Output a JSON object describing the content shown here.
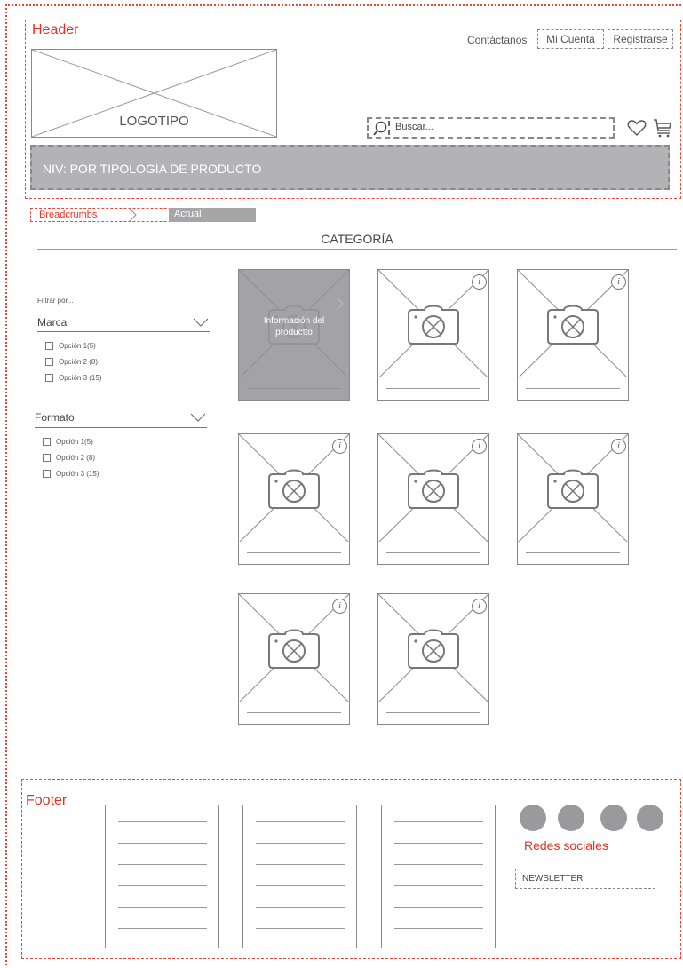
{
  "header": {
    "label": "Header",
    "contact_link": "Contáctanos",
    "account_button": "Mi Cuenta",
    "register_button": "Registrarse",
    "logo_label": "LOGOTIPO",
    "search_placeholder": "Buscar...",
    "nav_label": "NIV: POR TIPOLOGÍA DE PRODUCTO"
  },
  "breadcrumbs": {
    "first": "Breadcrumbs",
    "current": "Actual"
  },
  "category_title": "CATEGORÍA",
  "filters": {
    "heading": "Filtrar por...",
    "groups": [
      {
        "label": "Marca",
        "options": [
          "Opción 1(5)",
          "Opción 2 (8)",
          "Opción 3 (15)"
        ]
      },
      {
        "label": "Formato",
        "options": [
          "Opción 1(5)",
          "Opción 2 (8)",
          "Opción 3 (15)"
        ]
      }
    ]
  },
  "product_hover_text": "Información del productto",
  "footer": {
    "label": "Footer",
    "social_label": "Redes sociales",
    "newsletter_label": "NEWSLETTER"
  },
  "colors": {
    "accent_red": "#e2321f",
    "wire_gray": "#888888",
    "nav_fill": "#b3b3b5",
    "hover_fill": "#a3a3a5"
  }
}
